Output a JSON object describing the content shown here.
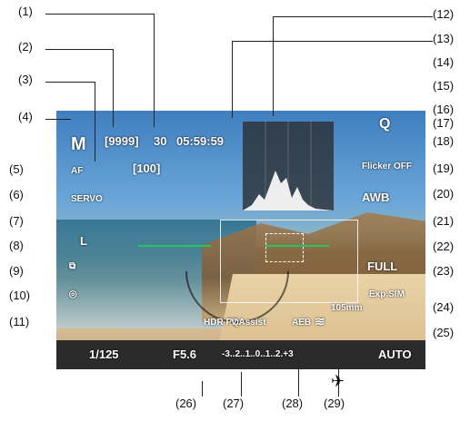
{
  "callouts": [
    "(1)",
    "(2)",
    "(3)",
    "(4)",
    "(5)",
    "(6)",
    "(7)",
    "(8)",
    "(9)",
    "(10)",
    "(11)",
    "(12)",
    "(13)",
    "(14)",
    "(15)",
    "(16)",
    "(17)",
    "(18)",
    "(19)",
    "(20)",
    "(21)",
    "(22)",
    "(23)",
    "(24)",
    "(25)",
    "(26)",
    "(27)",
    "(28)",
    "(29)"
  ],
  "hud": {
    "shots_bracket": "[9999]",
    "burst": "30",
    "buffer": "[100]",
    "time": "05:59:59",
    "mode": "M",
    "af_mode": "SERVO",
    "servo": "AF",
    "quality_l": "L",
    "flicker": "Flicker OFF",
    "awb": "AWB",
    "full": "FULL",
    "exp_sim": "Exp.SIM",
    "focal": "105mm",
    "hdr": "HDR PQ",
    "vassist": "V.Assist",
    "aeb": "AEB",
    "shutter": "1/125",
    "aperture": "F5.6",
    "iso": "AUTO",
    "exposure_scale": "-3..2..1..0..1..2.+3"
  }
}
